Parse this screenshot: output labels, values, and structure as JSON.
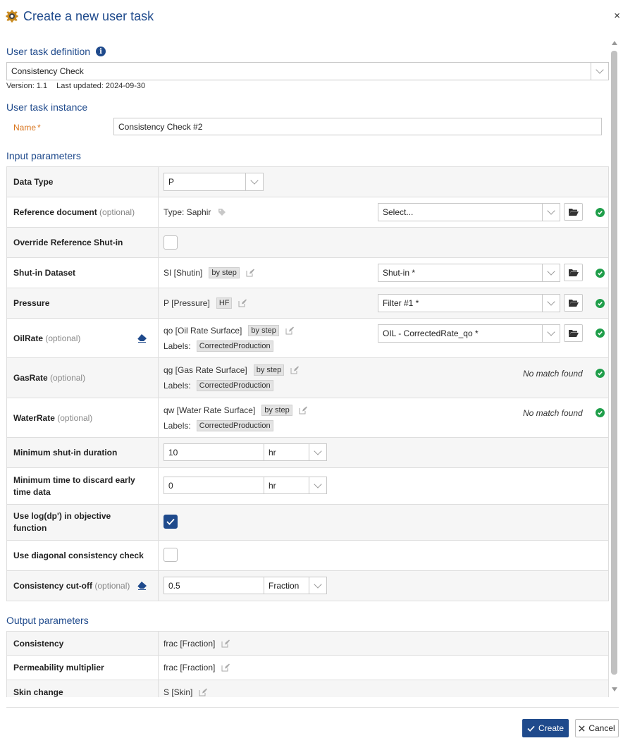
{
  "dialog": {
    "title": "Create a new user task",
    "close": "×"
  },
  "definition": {
    "heading": "User task definition",
    "info": "i",
    "selected": "Consistency Check",
    "version": "Version: 1.1",
    "updated": "Last updated: 2024-09-30"
  },
  "instance": {
    "heading": "User task instance",
    "name_label": "Name",
    "required_mark": "*",
    "name_value": "Consistency Check #2"
  },
  "inputs": {
    "heading": "Input parameters",
    "optional": "(optional)",
    "data_type": {
      "label": "Data Type",
      "value": "P"
    },
    "reference_doc": {
      "label": "Reference document",
      "type_text": "Type: Saphir",
      "select_placeholder": "Select..."
    },
    "override_shutin": {
      "label": "Override Reference Shut-in",
      "checked": false
    },
    "shutin_dataset": {
      "label": "Shut-in Dataset",
      "mapping": "SI [Shutin]",
      "tag": "by step",
      "select": "Shut-in *"
    },
    "pressure": {
      "label": "Pressure",
      "mapping": "P [Pressure]",
      "tag": "HF",
      "select": "Filter #1 *"
    },
    "oil_rate": {
      "label": "OilRate",
      "mapping": "qo [Oil Rate Surface]",
      "tag": "by step",
      "labels_prefix": "Labels:",
      "label_tag": "CorrectedProduction",
      "select": "OIL - CorrectedRate_qo *"
    },
    "gas_rate": {
      "label": "GasRate",
      "mapping": "qg [Gas Rate Surface]",
      "tag": "by step",
      "labels_prefix": "Labels:",
      "label_tag": "CorrectedProduction",
      "status": "No match found"
    },
    "water_rate": {
      "label": "WaterRate",
      "mapping": "qw [Water Rate Surface]",
      "tag": "by step",
      "labels_prefix": "Labels:",
      "label_tag": "CorrectedProduction",
      "status": "No match found"
    },
    "min_shutin": {
      "label": "Minimum shut-in duration",
      "value": "10",
      "unit": "hr"
    },
    "min_time_discard": {
      "label_line1": "Minimum time to discard early",
      "label_line2": "time data",
      "value": "0",
      "unit": "hr"
    },
    "use_log": {
      "label_line1": "Use log(dp') in objective",
      "label_line2": "function",
      "checked": true
    },
    "use_diagonal": {
      "label": "Use diagonal consistency check",
      "checked": false
    },
    "cutoff": {
      "label": "Consistency cut-off",
      "value": "0.5",
      "unit": "Fraction"
    }
  },
  "outputs": {
    "heading": "Output parameters",
    "rows": [
      {
        "label": "Consistency",
        "mapping": "frac [Fraction]"
      },
      {
        "label": "Permeability multiplier",
        "mapping": "frac [Fraction]"
      },
      {
        "label": "Skin change",
        "mapping": "S [Skin]"
      }
    ]
  },
  "footer": {
    "create": "Create",
    "cancel": "Cancel"
  },
  "colors": {
    "primary": "#1f4a8c",
    "success": "#1f9e4a",
    "required": "#d9731a"
  },
  "icons": [
    "gear-icon",
    "close-icon",
    "info-icon",
    "chevron-down-icon",
    "tag-icon",
    "edit-icon",
    "folder-open-icon",
    "check-circle-icon",
    "eraser-icon",
    "check-icon"
  ]
}
